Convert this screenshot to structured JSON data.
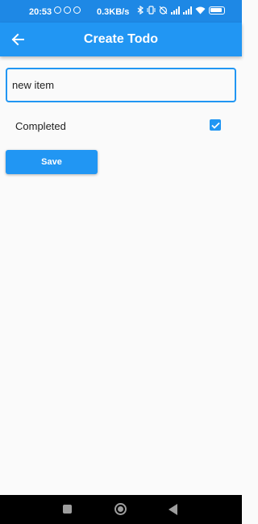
{
  "status_bar": {
    "time": "20:53",
    "net_speed": "0.3KB/s",
    "icons": [
      "whatsapp-icon",
      "move-icon",
      "d-icon",
      "bluetooth-icon",
      "vibrate-icon",
      "alarm-off-icon",
      "signal-icon",
      "signal-4g-icon",
      "wifi-icon",
      "battery-icon"
    ]
  },
  "app_bar": {
    "title": "Create Todo",
    "back_icon": "arrow-back-icon",
    "color": "#2196f3"
  },
  "form": {
    "title_value": "new item",
    "completed_label": "Completed",
    "completed_checked": true,
    "save_label": "Save"
  },
  "nav_bar": {
    "buttons": [
      "recents-icon",
      "home-icon",
      "back-icon"
    ]
  }
}
